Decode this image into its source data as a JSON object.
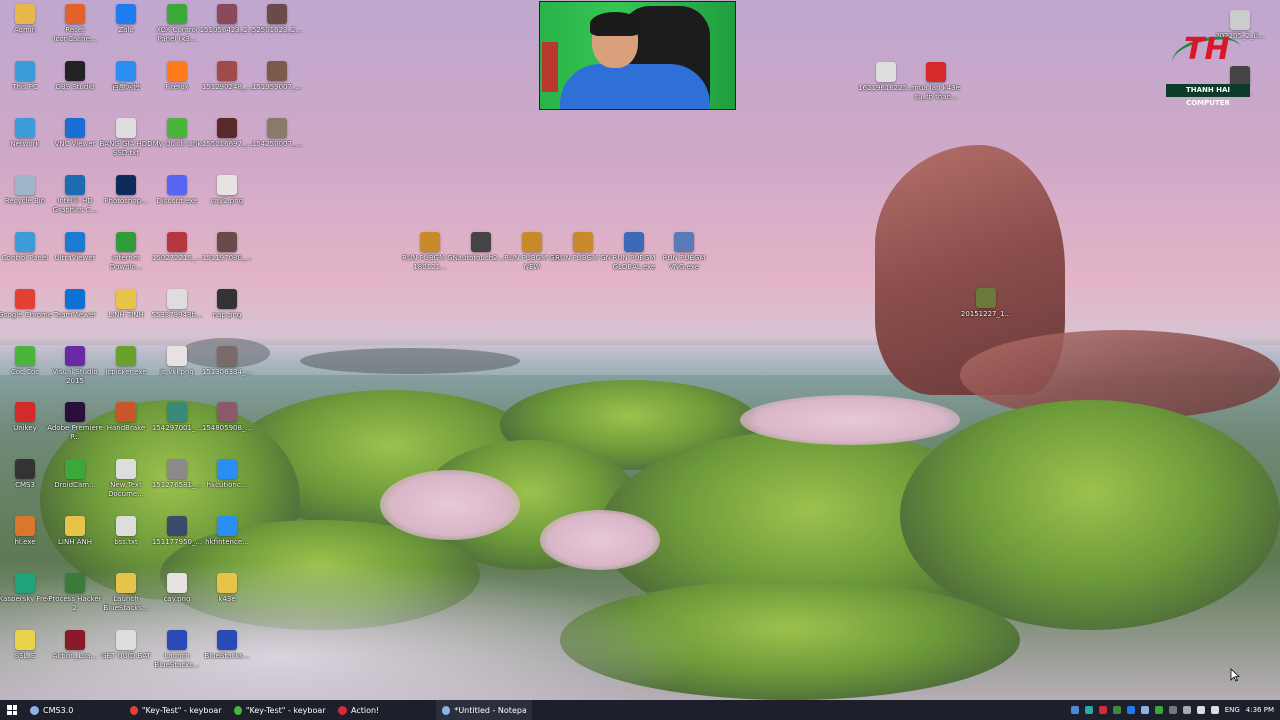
{
  "desktop": {
    "icons": [
      {
        "label": "Admin",
        "icon": "user-folder-icon",
        "color": "#e8b84a"
      },
      {
        "label": "Reset IconCache...",
        "icon": "reset-icon",
        "color": "#e2622a"
      },
      {
        "label": "Zalo",
        "icon": "zalo-icon",
        "color": "#1e7cf2"
      },
      {
        "label": "XOX Control Panel (x3...",
        "icon": "control-panel-icon",
        "color": "#3aa93a"
      },
      {
        "label": "151056423_2...",
        "icon": "image-file-icon",
        "color": "#8a4a5a"
      },
      {
        "label": "52501623_2...",
        "icon": "image-file-icon",
        "color": "#6a4a4a"
      },
      {
        "label": "This PC",
        "icon": "computer-icon",
        "color": "#3c9bd9"
      },
      {
        "label": "OBS Studio",
        "icon": "obs-icon",
        "color": "#222222"
      },
      {
        "label": "百度网盘",
        "icon": "baidu-cloud-icon",
        "color": "#2a8ef2"
      },
      {
        "label": "Firefox",
        "icon": "firefox-icon",
        "color": "#ff7a18"
      },
      {
        "label": "151290248_...",
        "icon": "image-file-icon",
        "color": "#a04a4a"
      },
      {
        "label": "151959007_...",
        "icon": "image-file-icon",
        "color": "#7a5a4a"
      },
      {
        "label": "Network",
        "icon": "network-icon",
        "color": "#3c9bd9"
      },
      {
        "label": "VNC Viewer",
        "icon": "vnc-icon",
        "color": "#1a6fd4"
      },
      {
        "label": "BANG GIA HDD SSD.txt",
        "icon": "text-file-icon",
        "color": "#dddddd"
      },
      {
        "label": "My Quick Link",
        "icon": "link-icon",
        "color": "#4bb43a"
      },
      {
        "label": "155016697_...",
        "icon": "image-file-icon",
        "color": "#5a2a2a"
      },
      {
        "label": "154250007_...",
        "icon": "image-file-icon",
        "color": "#8a7a6a"
      },
      {
        "label": "Recycle Bin",
        "icon": "recycle-bin-icon",
        "color": "#9fb5c9"
      },
      {
        "label": "Intel® HD Graphics C...",
        "icon": "intel-graphics-icon",
        "color": "#1d6bb0"
      },
      {
        "label": "Photoshop...",
        "icon": "photoshop-icon",
        "color": "#0f2a5a"
      },
      {
        "label": "Discord.exe",
        "icon": "discord-icon",
        "color": "#5865f2"
      },
      {
        "label": "cay2.png",
        "icon": "image-file-icon",
        "color": "#e9e2e2"
      },
      {
        "label": "Control Panel",
        "icon": "control-panel-icon",
        "color": "#3c9bd9"
      },
      {
        "label": "UltraViewer",
        "icon": "ultraviewer-icon",
        "color": "#1a7ad4"
      },
      {
        "label": "Internet Downlo...",
        "icon": "idm-icon",
        "color": "#2f9e3a"
      },
      {
        "label": "150272215_...",
        "icon": "image-file-icon",
        "color": "#b8373e"
      },
      {
        "label": "151197080_...",
        "icon": "image-file-icon",
        "color": "#6a4a4a"
      },
      {
        "label": "Google Chrome",
        "icon": "chrome-icon",
        "color": "#e44134"
      },
      {
        "label": "TeamViewer",
        "icon": "teamviewer-icon",
        "color": "#0e6fd4"
      },
      {
        "label": "LINH TINH",
        "icon": "folder-icon",
        "color": "#e8c34a"
      },
      {
        "label": "553379943b...",
        "icon": "text-file-icon",
        "color": "#dddddd"
      },
      {
        "label": "nap.png",
        "icon": "image-file-icon",
        "color": "#333333"
      },
      {
        "label": "Cốc Cốc",
        "icon": "coccoc-icon",
        "color": "#4bb43a"
      },
      {
        "label": "Visual Studio 2015",
        "icon": "visual-studio-icon",
        "color": "#6a2aa8"
      },
      {
        "label": "jcpicker.exe",
        "icon": "color-picker-icon",
        "color": "#6aa12a"
      },
      {
        "label": "jc.vkl.png",
        "icon": "image-file-icon",
        "color": "#e9e2e2"
      },
      {
        "label": "151306334_...",
        "icon": "image-file-icon",
        "color": "#7a6a6a"
      },
      {
        "label": "Unikey",
        "icon": "unikey-icon",
        "color": "#d42a2a"
      },
      {
        "label": "Adobe Premiere P...",
        "icon": "premiere-icon",
        "color": "#2a0f3a"
      },
      {
        "label": "HandBrake",
        "icon": "handbrake-icon",
        "color": "#c9562a"
      },
      {
        "label": "154297001_...",
        "icon": "image-file-icon",
        "color": "#3a8a7a"
      },
      {
        "label": "154805908_...",
        "icon": "image-file-icon",
        "color": "#8a5a6a"
      },
      {
        "label": "CMS3",
        "icon": "camera-icon",
        "color": "#333333"
      },
      {
        "label": "DroidCam...",
        "icon": "droidcam-icon",
        "color": "#3aa93a"
      },
      {
        "label": "New Text Docume...",
        "icon": "text-file-icon",
        "color": "#dddddd"
      },
      {
        "label": "151276581_...",
        "icon": "image-file-icon",
        "color": "#8a8a8a"
      },
      {
        "label": "hkcutionc...",
        "icon": "file-icon",
        "color": "#2a8ef2"
      },
      {
        "label": "hl.exe",
        "icon": "app-icon",
        "color": "#d9782a"
      },
      {
        "label": "LINH ANH",
        "icon": "folder-icon",
        "color": "#e8c34a"
      },
      {
        "label": "bss.txt",
        "icon": "text-file-icon",
        "color": "#dddddd"
      },
      {
        "label": "151177950_...",
        "icon": "image-file-icon",
        "color": "#3a4a6a"
      },
      {
        "label": "hkfintence...",
        "icon": "file-icon",
        "color": "#2a8ef2"
      },
      {
        "label": "Kaspersky Free",
        "icon": "kaspersky-icon",
        "color": "#1fa37a"
      },
      {
        "label": "Process Hacker 2",
        "icon": "process-hacker-icon",
        "color": "#3a7a3a"
      },
      {
        "label": "Launch BlueStacks...",
        "icon": "folder-icon",
        "color": "#e8c34a"
      },
      {
        "label": "cay.png",
        "icon": "image-file-icon",
        "color": "#e9e2e2"
      },
      {
        "label": "k43e",
        "icon": "folder-icon",
        "color": "#e8c34a"
      },
      {
        "label": "SSL_S",
        "icon": "folder-icon",
        "color": "#e8d34a"
      },
      {
        "label": "Action_Loa...",
        "icon": "action-icon",
        "color": "#8a1a2a"
      },
      {
        "label": "GET UUID.BAT",
        "icon": "batch-file-icon",
        "color": "#dddddd"
      },
      {
        "label": "Launch BlueStacks...",
        "icon": "bluestacks-icon",
        "color": "#2a4ab8"
      },
      {
        "label": "BlueStacks...",
        "icon": "bluestacks-icon",
        "color": "#2a4ab8"
      },
      {
        "label": "RUN PUBGM GN 180121...",
        "icon": "pubg-icon",
        "color": "#c98a2a"
      },
      {
        "label": "autotouch2...",
        "icon": "autotouch-icon",
        "color": "#444444"
      },
      {
        "label": "RUN PUBGM GN NEW",
        "icon": "pubg-icon",
        "color": "#c98a2a"
      },
      {
        "label": "RUN PUBGM GN",
        "icon": "pubg-icon",
        "color": "#c98a2a"
      },
      {
        "label": "RUN PUBGM GLOBAL.exe",
        "icon": "pubg-icon",
        "color": "#3a6ab8"
      },
      {
        "label": "RUN PUBGM VNG.exe",
        "icon": "pubg-icon",
        "color": "#5a7ab8"
      },
      {
        "label": "16219616225...",
        "icon": "text-file-icon",
        "color": "#dddddd"
      },
      {
        "label": "mua lap k43e cu_fb than...",
        "icon": "pdf-file-icon",
        "color": "#d42a2a"
      },
      {
        "label": "20151227_1...",
        "icon": "image-file-icon",
        "color": "#6a7a3a"
      },
      {
        "label": "202105_2_0...",
        "icon": "monitor-icon",
        "color": "#cccccc"
      },
      {
        "label": "2021...",
        "icon": "video-file-icon",
        "color": "#444444"
      }
    ]
  },
  "logo": {
    "mark": "TH",
    "name": "THANH HAI COMPUTER"
  },
  "taskbar": {
    "items": [
      {
        "label": "CMS3.0",
        "icon": "people-icon",
        "color": "#8ab4e8"
      },
      {
        "label": "\"Key-Test\" - keyboard...",
        "icon": "chrome-icon",
        "color": "#e44134"
      },
      {
        "label": "\"Key-Test\" - keyboard...",
        "icon": "coccoc-icon",
        "color": "#4bb43a"
      },
      {
        "label": "Action!",
        "icon": "action-icon",
        "color": "#d42a3a"
      },
      {
        "label": "*Untitled - Notepad",
        "icon": "notepad-icon",
        "color": "#8ab4e8"
      }
    ],
    "tray": {
      "language": "ENG",
      "time": "4:36 PM"
    }
  }
}
